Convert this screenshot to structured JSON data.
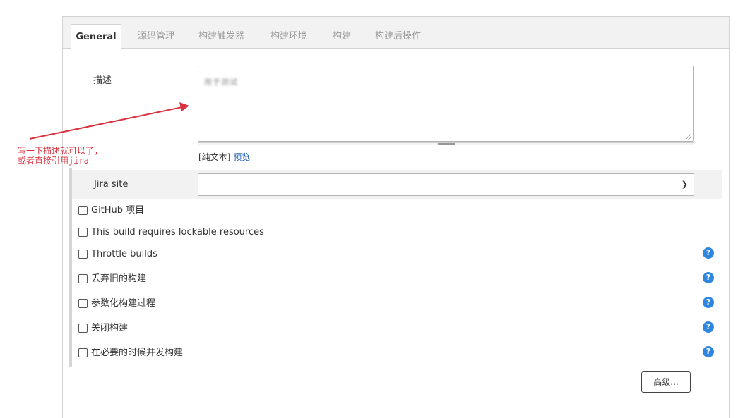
{
  "tabs": [
    {
      "label": "General",
      "active": true
    },
    {
      "label": "源码管理",
      "active": false
    },
    {
      "label": "构建触发器",
      "active": false
    },
    {
      "label": "构建环境",
      "active": false
    },
    {
      "label": "构建",
      "active": false
    },
    {
      "label": "构建后操作",
      "active": false
    }
  ],
  "description": {
    "label": "描述",
    "value": "用于测试",
    "hint_text": "[纯文本]",
    "preview_link": "预览"
  },
  "jira": {
    "label": "Jira site",
    "selected": ""
  },
  "options": [
    {
      "label": "GitHub 项目",
      "checked": false,
      "help": false
    },
    {
      "label": "This build requires lockable resources",
      "checked": false,
      "help": false
    },
    {
      "label": "Throttle builds",
      "checked": false,
      "help": true
    },
    {
      "label": "丢弃旧的构建",
      "checked": false,
      "help": true
    },
    {
      "label": "参数化构建过程",
      "checked": false,
      "help": true
    },
    {
      "label": "关闭构建",
      "checked": false,
      "help": true
    },
    {
      "label": "在必要的时候并发构建",
      "checked": false,
      "help": true
    }
  ],
  "help_glyph": "?",
  "advanced_button": "高级...",
  "annotation": {
    "line1": "写一下描述就可以了,",
    "line2": "或者直接引用jira",
    "color": "#d9333f"
  },
  "icons": {
    "dropdown": "chevron-down-icon",
    "help": "help-icon",
    "arrow": "annotation-arrow-icon"
  }
}
